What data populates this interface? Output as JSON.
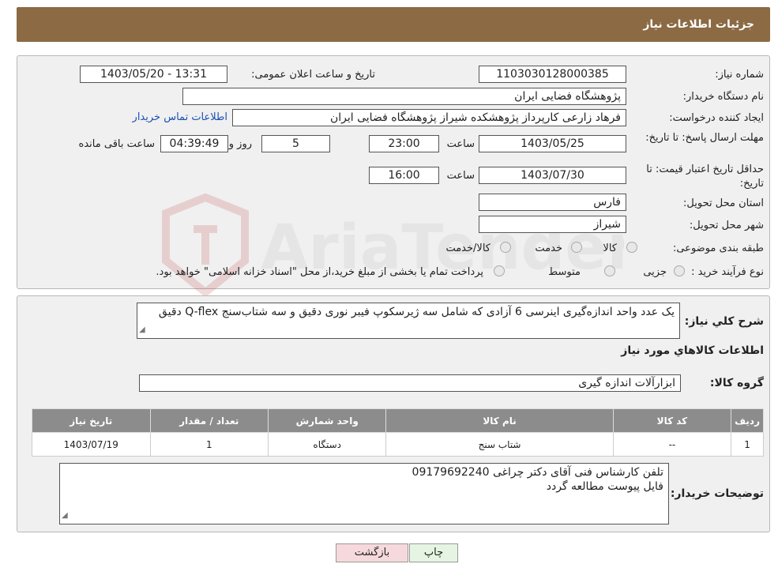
{
  "header": {
    "title": "جزئیات اطلاعات نیاز"
  },
  "labels": {
    "need_number": "شماره نیاز:",
    "announce_datetime": "تاریخ و ساعت اعلان عمومی:",
    "buyer_org": "نام دستگاه خریدار:",
    "requester": "ایجاد کننده درخواست:",
    "response_deadline": "مهلت ارسال پاسخ: تا تاریخ:",
    "time": "ساعت",
    "day_and": "روز و",
    "remaining": "ساعت باقی مانده",
    "price_validity": "حداقل تاریخ اعتبار قیمت: تا تاریخ:",
    "province": "استان محل تحویل:",
    "city": "شهر محل تحویل:",
    "category": "طبقه بندی موضوعی:",
    "process_type": "نوع فرآیند خرید :",
    "description": "شرح کلي نياز:",
    "goods_info": "اطلاعات کالاهاي مورد نياز",
    "goods_group": "گروه کالا:",
    "buyer_notes": "توضیحات خریدار:"
  },
  "values": {
    "need_number": "1103030128000385",
    "announce_datetime": "1403/05/20 - 13:31",
    "buyer_org": "پژوهشگاه فضایی ایران",
    "requester": "فرهاد زارعی کارپرداز پژوهشکده شیراز پژوهشگاه فضایی ایران",
    "contact_link": "اطلاعات تماس خریدار",
    "response_date": "1403/05/25",
    "response_time": "23:00",
    "days": "5",
    "remaining_time": "04:39:49",
    "price_date": "1403/07/30",
    "price_time": "16:00",
    "province": "فارس",
    "city": "شیراز",
    "description": "یک عدد واحد اندازه‌گیری اینرسی 6 آزادی که شامل سه ژیرسکوپ فیبر نوری دقیق و سه شتاب‌سنج Q-flex دقیق",
    "goods_group": "ابزارآلات اندازه گیری",
    "notes_line1": "تلفن کارشناس فنی آقای دکتر چراغی 09179692240",
    "notes_line2": "فایل پیوست مطالعه گردد"
  },
  "category_options": [
    "کالا",
    "خدمت",
    "کالا/خدمت"
  ],
  "process_options": [
    "جزیی",
    "متوسط"
  ],
  "process_note": "پرداخت تمام یا بخشی از مبلغ خرید،از محل \"اسناد خزانه اسلامی\" خواهد بود.",
  "table": {
    "headers": [
      "ردیف",
      "کد کالا",
      "نام کالا",
      "واحد شمارش",
      "تعداد / مقدار",
      "تاریخ نیاز"
    ],
    "rows": [
      [
        "1",
        "--",
        "شتاب سنج",
        "دستگاه",
        "1",
        "1403/07/19"
      ]
    ]
  },
  "buttons": {
    "print": "چاپ",
    "back": "بازگشت"
  },
  "watermark": "AriaTender.neT",
  "colors": {
    "header": "#8b6a44",
    "table_header": "#8c8c8c",
    "link": "#1b4fb5",
    "back_button": "#f6d9dc",
    "print_button": "#e6f5e3"
  }
}
